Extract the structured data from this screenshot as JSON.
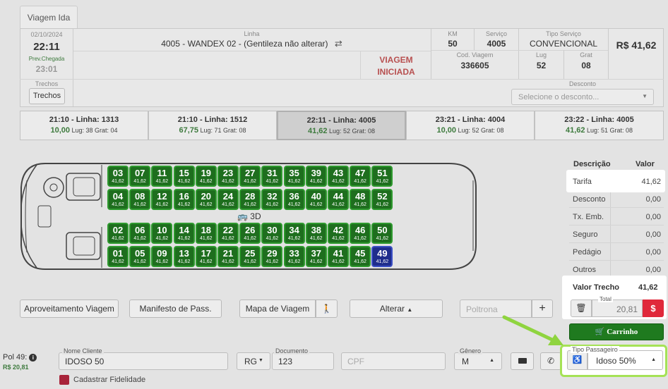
{
  "tab": {
    "label": "Viagem Ida"
  },
  "trip": {
    "date": "02/10/2024",
    "time": "22:11",
    "arrival_label": "Prev.Chegada",
    "arrival_time": "23:01",
    "line_label": "Linha",
    "line_value": "4005 - WANDEX 02 - (Gentileza não alterar)",
    "status_line1": "VIAGEM",
    "status_line2": "INICIADA",
    "km_label": "KM",
    "km_value": "50",
    "service_label": "Serviço",
    "service_value": "4005",
    "service_type_label": "Tipo Serviço",
    "service_type_value": "CONVENCIONAL",
    "price": "R$ 41,62",
    "trip_code_label": "Cod. Viagem",
    "trip_code_value": "336605",
    "seats_label": "Lug",
    "seats_value": "52",
    "free_label": "Grat",
    "free_value": "08",
    "segments_label": "Trechos",
    "segments_button": "Trechos",
    "discount_label": "Desconto",
    "discount_placeholder": "Selecione o desconto..."
  },
  "trips": [
    {
      "title": "21:10 - Linha: 1313",
      "price": "10,00",
      "info": "Lug: 38 Grat: 04"
    },
    {
      "title": "21:10 - Linha: 1512",
      "price": "67,75",
      "info": "Lug: 71 Grat: 08"
    },
    {
      "title": "22:11 - Linha: 4005",
      "price": "41,62",
      "info": "Lug: 52 Grat: 08"
    },
    {
      "title": "23:21 - Linha: 4004",
      "price": "10,00",
      "info": "Lug: 52 Grat: 08"
    },
    {
      "title": "23:22 - Linha: 4005",
      "price": "41,62",
      "info": "Lug: 51 Grat: 08"
    }
  ],
  "bus": {
    "label": "3D",
    "seat_price": "41,62",
    "rows": [
      [
        "03",
        "07",
        "11",
        "15",
        "19",
        "23",
        "27",
        "31",
        "35",
        "39",
        "43",
        "47",
        "51"
      ],
      [
        "04",
        "08",
        "12",
        "16",
        "20",
        "24",
        "28",
        "32",
        "36",
        "40",
        "44",
        "48",
        "52"
      ],
      [
        "02",
        "06",
        "10",
        "14",
        "18",
        "22",
        "26",
        "30",
        "34",
        "38",
        "42",
        "46",
        "50"
      ],
      [
        "01",
        "05",
        "09",
        "13",
        "17",
        "21",
        "25",
        "29",
        "33",
        "37",
        "41",
        "45",
        "49"
      ]
    ],
    "selected": "49"
  },
  "summary": {
    "desc_header": "Descrição",
    "value_header": "Valor",
    "rows": [
      {
        "label": "Tarifa",
        "value": "41,62"
      },
      {
        "label": "Desconto",
        "value": "0,00"
      },
      {
        "label": "Tx. Emb.",
        "value": "0,00"
      },
      {
        "label": "Seguro",
        "value": "0,00"
      },
      {
        "label": "Pedágio",
        "value": "0,00"
      },
      {
        "label": "Outros",
        "value": "0,00"
      }
    ],
    "segment_value_label": "Valor Trecho",
    "segment_value": "41,62",
    "total_label": "Total",
    "total_value": "20,81",
    "cart_button": "Carrinho"
  },
  "actions": {
    "reuse": "Aproveitamento Viagem",
    "manifest": "Manifesto de Pass.",
    "trip_map": "Mapa de Viagem",
    "change": "Alterar",
    "poltrona_placeholder": "Poltrona"
  },
  "passenger": {
    "seat_label": "Pol 49:",
    "seat_price": "R$ 20,81",
    "name_label": "Nome Cliente",
    "name_value": "IDOSO 50",
    "doc_type": "RG",
    "doc_label": "Documento",
    "doc_value": "123",
    "cpf_placeholder": "CPF",
    "gender_label": "Gênero",
    "gender_value": "M",
    "type_label": "Tipo Passageiro",
    "type_value": "Idoso 50%",
    "loyalty": "Cadastrar Fidelidade"
  }
}
